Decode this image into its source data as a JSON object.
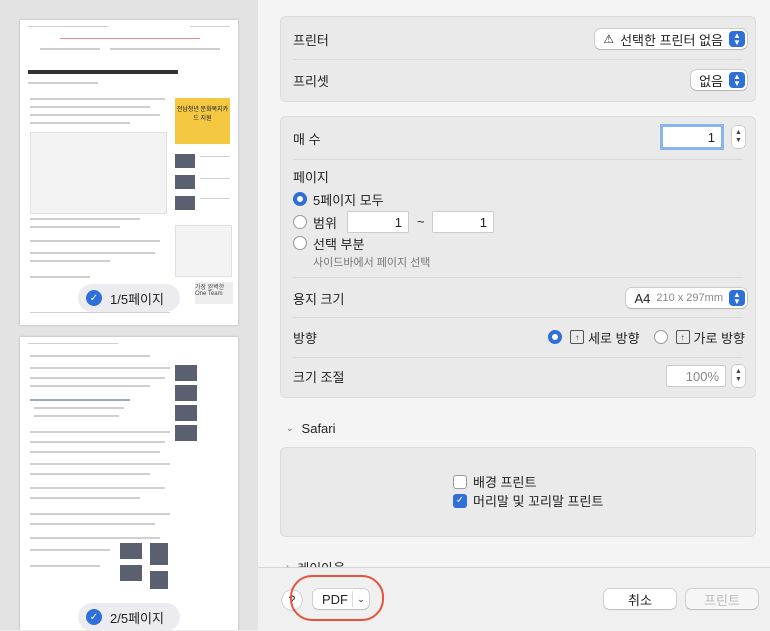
{
  "preview": {
    "page1_badge": "1/5페이지",
    "page2_badge": "2/5페이지",
    "ad_banner_text": "전남청년 문화복지카드 지원",
    "ad2_text": "가장 완벽한 One Team"
  },
  "settings": {
    "printer": {
      "label": "프린터",
      "value": "선택한 프린터 없음"
    },
    "preset": {
      "label": "프리셋",
      "value": "없음"
    },
    "copies": {
      "label": "매 수",
      "value": "1"
    },
    "pages": {
      "label": "페이지",
      "option_all": "5페이지 모두",
      "option_range": "범위",
      "range_from": "1",
      "range_sep": "~",
      "range_to": "1",
      "option_selection": "선택 부분",
      "selection_hint": "사이드바에서 페이지 선택"
    },
    "paper_size": {
      "label": "용지 크기",
      "value": "A4",
      "dims": "210 x 297mm"
    },
    "orientation": {
      "label": "방향",
      "portrait": "세로 방향",
      "landscape": "가로 방향"
    },
    "scale": {
      "label": "크기 조절",
      "value": "100%"
    }
  },
  "safari": {
    "title": "Safari",
    "print_backgrounds": "배경 프린트",
    "print_headers_footers": "머리말 및 꼬리말 프린트"
  },
  "layout_section": {
    "title": "레이아웃"
  },
  "footer": {
    "help": "?",
    "pdf": "PDF",
    "cancel": "취소",
    "print": "프린트"
  }
}
